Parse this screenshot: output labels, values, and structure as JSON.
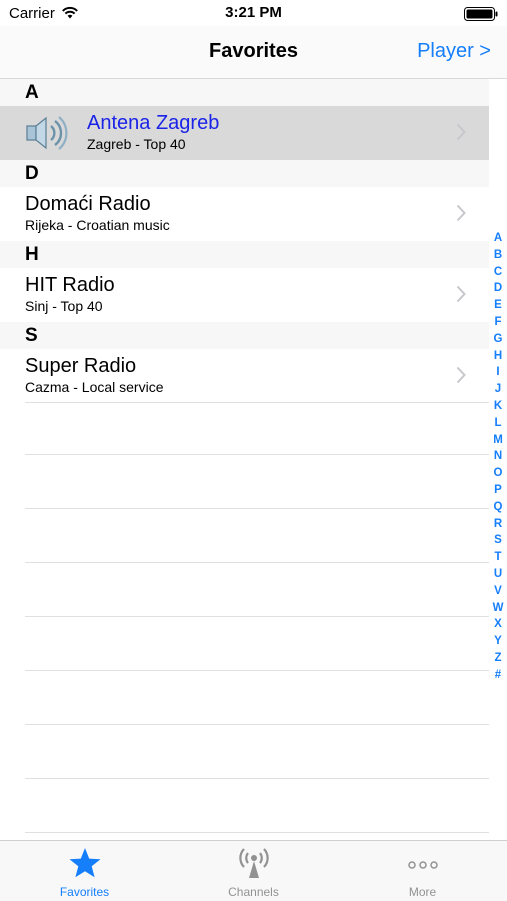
{
  "status_bar": {
    "carrier": "Carrier",
    "time": "3:21 PM"
  },
  "nav": {
    "title": "Favorites",
    "right_button": "Player >"
  },
  "sections": [
    {
      "letter": "A",
      "stations": [
        {
          "name": "Antena Zagreb",
          "subtitle": "Zagreb - Top 40",
          "selected": true,
          "icon": "speaker-icon"
        }
      ]
    },
    {
      "letter": "D",
      "stations": [
        {
          "name": "Domaći Radio",
          "subtitle": "Rijeka - Croatian music"
        }
      ]
    },
    {
      "letter": "H",
      "stations": [
        {
          "name": "HIT Radio",
          "subtitle": "Sinj - Top 40"
        }
      ]
    },
    {
      "letter": "S",
      "stations": [
        {
          "name": "Super Radio",
          "subtitle": "Cazma - Local service"
        }
      ]
    }
  ],
  "index_letters": [
    "A",
    "B",
    "C",
    "D",
    "E",
    "F",
    "G",
    "H",
    "I",
    "J",
    "K",
    "L",
    "M",
    "N",
    "O",
    "P",
    "Q",
    "R",
    "S",
    "T",
    "U",
    "V",
    "W",
    "X",
    "Y",
    "Z",
    "#"
  ],
  "tabs": [
    {
      "label": "Favorites",
      "icon": "star-icon",
      "active": true
    },
    {
      "label": "Channels",
      "icon": "antenna-icon",
      "active": false
    },
    {
      "label": "More",
      "icon": "more-dots-icon",
      "active": false
    }
  ],
  "colors": {
    "accent": "#157efb",
    "selected_text": "#1a23e8",
    "selected_row": "#d9d9d9"
  }
}
